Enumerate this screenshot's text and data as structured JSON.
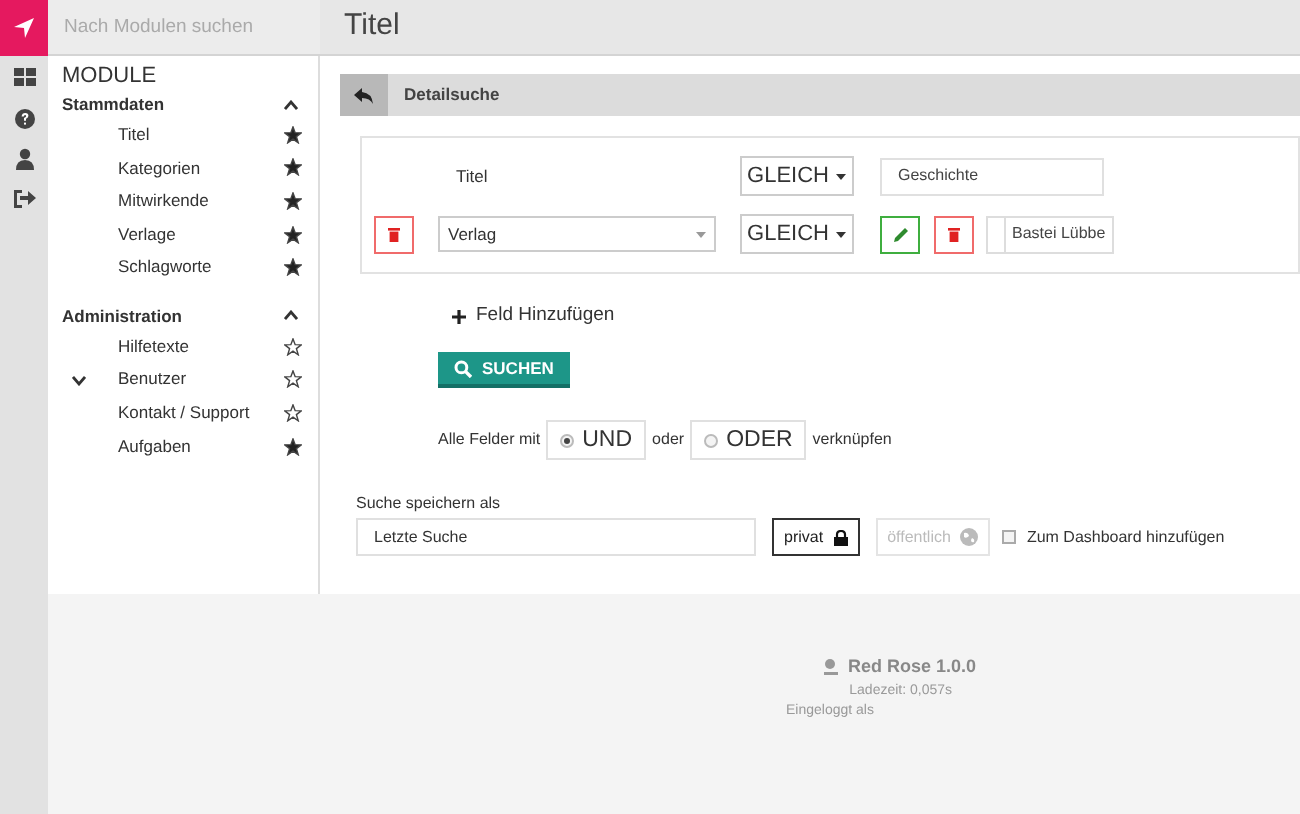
{
  "search": {
    "placeholder": "Nach Modulen suchen"
  },
  "page_title": "Titel",
  "rail": [
    {
      "kind": "dashboard"
    },
    {
      "kind": "help"
    },
    {
      "kind": "user"
    },
    {
      "kind": "logout"
    }
  ],
  "sidebar": {
    "title": "MODULE",
    "groups": [
      {
        "label": "Stammdaten",
        "expanded": true,
        "items": [
          {
            "label": "Titel",
            "kind": "leaf",
            "starred": true
          },
          {
            "label": "Kategorien",
            "kind": "leaf",
            "starred": true
          },
          {
            "label": "Mitwirkende",
            "kind": "leaf",
            "starred": true
          },
          {
            "label": "Verlage",
            "kind": "leaf",
            "starred": true
          },
          {
            "label": "Schlagworte",
            "kind": "leaf",
            "starred": true
          }
        ]
      },
      {
        "label": "Administration",
        "expanded": true,
        "items": [
          {
            "label": "Hilfetexte",
            "kind": "leaf",
            "starred": false
          },
          {
            "label": "Benutzer",
            "kind": "parent",
            "starred": false
          },
          {
            "label": "Kontakt / Support",
            "kind": "leaf",
            "starred": false
          },
          {
            "label": "Aufgaben",
            "kind": "leaf",
            "starred": true
          }
        ]
      }
    ]
  },
  "panel": {
    "title": "Detailsuche",
    "criteria": [
      {
        "kind": "fixed",
        "field": "Titel",
        "operator": "GLEICH",
        "value": "Geschichte"
      },
      {
        "kind": "editable",
        "field": "Verlag",
        "operator": "GLEICH",
        "value": "Bastei Lübbe"
      }
    ],
    "add_field": "Feld Hinzufügen",
    "search_button": "SUCHEN",
    "combine": {
      "prefix": "Alle Felder mit",
      "middle": "oder",
      "suffix": "verknüpfen",
      "options": [
        {
          "label": "UND",
          "selected": true
        },
        {
          "label": "ODER",
          "selected": false
        }
      ]
    },
    "save": {
      "label": "Suche speichern als",
      "value": "Letzte Suche",
      "visibility": [
        {
          "label": "privat",
          "kind": "lock",
          "selected": true
        },
        {
          "label": "öffentlich",
          "kind": "globe",
          "selected": false
        }
      ],
      "dashboard": {
        "label": "Zum Dashboard hinzufügen",
        "checked": false
      }
    }
  },
  "footer": {
    "product": "Red Rose 1.0.0",
    "load_time": "Ladezeit: 0,057s",
    "login": "Eingeloggt als"
  }
}
